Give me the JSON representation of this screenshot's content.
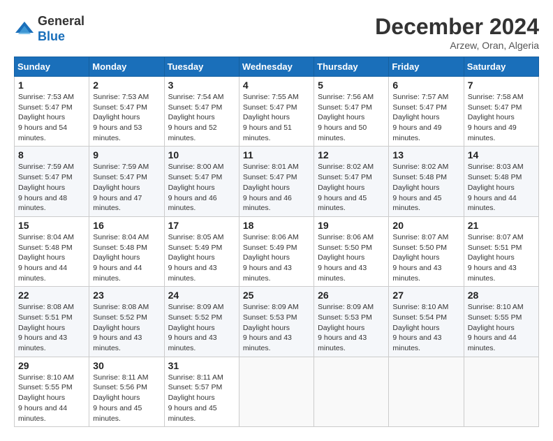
{
  "logo": {
    "general": "General",
    "blue": "Blue"
  },
  "header": {
    "month": "December 2024",
    "location": "Arzew, Oran, Algeria"
  },
  "weekdays": [
    "Sunday",
    "Monday",
    "Tuesday",
    "Wednesday",
    "Thursday",
    "Friday",
    "Saturday"
  ],
  "weeks": [
    [
      {
        "day": "1",
        "sunrise": "7:53 AM",
        "sunset": "5:47 PM",
        "daylight": "9 hours and 54 minutes."
      },
      {
        "day": "2",
        "sunrise": "7:53 AM",
        "sunset": "5:47 PM",
        "daylight": "9 hours and 53 minutes."
      },
      {
        "day": "3",
        "sunrise": "7:54 AM",
        "sunset": "5:47 PM",
        "daylight": "9 hours and 52 minutes."
      },
      {
        "day": "4",
        "sunrise": "7:55 AM",
        "sunset": "5:47 PM",
        "daylight": "9 hours and 51 minutes."
      },
      {
        "day": "5",
        "sunrise": "7:56 AM",
        "sunset": "5:47 PM",
        "daylight": "9 hours and 50 minutes."
      },
      {
        "day": "6",
        "sunrise": "7:57 AM",
        "sunset": "5:47 PM",
        "daylight": "9 hours and 49 minutes."
      },
      {
        "day": "7",
        "sunrise": "7:58 AM",
        "sunset": "5:47 PM",
        "daylight": "9 hours and 49 minutes."
      }
    ],
    [
      {
        "day": "8",
        "sunrise": "7:59 AM",
        "sunset": "5:47 PM",
        "daylight": "9 hours and 48 minutes."
      },
      {
        "day": "9",
        "sunrise": "7:59 AM",
        "sunset": "5:47 PM",
        "daylight": "9 hours and 47 minutes."
      },
      {
        "day": "10",
        "sunrise": "8:00 AM",
        "sunset": "5:47 PM",
        "daylight": "9 hours and 46 minutes."
      },
      {
        "day": "11",
        "sunrise": "8:01 AM",
        "sunset": "5:47 PM",
        "daylight": "9 hours and 46 minutes."
      },
      {
        "day": "12",
        "sunrise": "8:02 AM",
        "sunset": "5:47 PM",
        "daylight": "9 hours and 45 minutes."
      },
      {
        "day": "13",
        "sunrise": "8:02 AM",
        "sunset": "5:48 PM",
        "daylight": "9 hours and 45 minutes."
      },
      {
        "day": "14",
        "sunrise": "8:03 AM",
        "sunset": "5:48 PM",
        "daylight": "9 hours and 44 minutes."
      }
    ],
    [
      {
        "day": "15",
        "sunrise": "8:04 AM",
        "sunset": "5:48 PM",
        "daylight": "9 hours and 44 minutes."
      },
      {
        "day": "16",
        "sunrise": "8:04 AM",
        "sunset": "5:48 PM",
        "daylight": "9 hours and 44 minutes."
      },
      {
        "day": "17",
        "sunrise": "8:05 AM",
        "sunset": "5:49 PM",
        "daylight": "9 hours and 43 minutes."
      },
      {
        "day": "18",
        "sunrise": "8:06 AM",
        "sunset": "5:49 PM",
        "daylight": "9 hours and 43 minutes."
      },
      {
        "day": "19",
        "sunrise": "8:06 AM",
        "sunset": "5:50 PM",
        "daylight": "9 hours and 43 minutes."
      },
      {
        "day": "20",
        "sunrise": "8:07 AM",
        "sunset": "5:50 PM",
        "daylight": "9 hours and 43 minutes."
      },
      {
        "day": "21",
        "sunrise": "8:07 AM",
        "sunset": "5:51 PM",
        "daylight": "9 hours and 43 minutes."
      }
    ],
    [
      {
        "day": "22",
        "sunrise": "8:08 AM",
        "sunset": "5:51 PM",
        "daylight": "9 hours and 43 minutes."
      },
      {
        "day": "23",
        "sunrise": "8:08 AM",
        "sunset": "5:52 PM",
        "daylight": "9 hours and 43 minutes."
      },
      {
        "day": "24",
        "sunrise": "8:09 AM",
        "sunset": "5:52 PM",
        "daylight": "9 hours and 43 minutes."
      },
      {
        "day": "25",
        "sunrise": "8:09 AM",
        "sunset": "5:53 PM",
        "daylight": "9 hours and 43 minutes."
      },
      {
        "day": "26",
        "sunrise": "8:09 AM",
        "sunset": "5:53 PM",
        "daylight": "9 hours and 43 minutes."
      },
      {
        "day": "27",
        "sunrise": "8:10 AM",
        "sunset": "5:54 PM",
        "daylight": "9 hours and 43 minutes."
      },
      {
        "day": "28",
        "sunrise": "8:10 AM",
        "sunset": "5:55 PM",
        "daylight": "9 hours and 44 minutes."
      }
    ],
    [
      {
        "day": "29",
        "sunrise": "8:10 AM",
        "sunset": "5:55 PM",
        "daylight": "9 hours and 44 minutes."
      },
      {
        "day": "30",
        "sunrise": "8:11 AM",
        "sunset": "5:56 PM",
        "daylight": "9 hours and 45 minutes."
      },
      {
        "day": "31",
        "sunrise": "8:11 AM",
        "sunset": "5:57 PM",
        "daylight": "9 hours and 45 minutes."
      },
      null,
      null,
      null,
      null
    ]
  ],
  "labels": {
    "sunrise": "Sunrise:",
    "sunset": "Sunset:",
    "daylight": "Daylight hours"
  }
}
